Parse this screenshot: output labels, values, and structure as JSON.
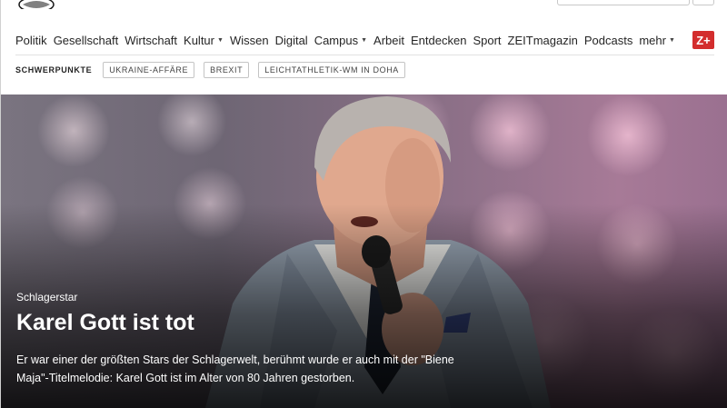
{
  "header": {
    "logo_text": "ZEIT ONLINE",
    "zplus_label": "Z+"
  },
  "nav": {
    "items": [
      {
        "label": "Politik",
        "has_caret": false
      },
      {
        "label": "Gesellschaft",
        "has_caret": false
      },
      {
        "label": "Wirtschaft",
        "has_caret": false
      },
      {
        "label": "Kultur",
        "has_caret": true
      },
      {
        "label": "Wissen",
        "has_caret": false
      },
      {
        "label": "Digital",
        "has_caret": false
      },
      {
        "label": "Campus",
        "has_caret": true
      },
      {
        "label": "Arbeit",
        "has_caret": false
      },
      {
        "label": "Entdecken",
        "has_caret": false
      },
      {
        "label": "Sport",
        "has_caret": false
      },
      {
        "label": "ZEITmagazin",
        "has_caret": false
      },
      {
        "label": "Podcasts",
        "has_caret": false
      },
      {
        "label": "mehr",
        "has_caret": true
      }
    ],
    "caret_icon": "chevron-down-icon"
  },
  "subnav": {
    "label": "SCHWERPUNKTE",
    "tags": [
      "UKRAINE-AFFÄRE",
      "BREXIT",
      "LEICHTATHLETIK-WM IN DOHA"
    ]
  },
  "hero": {
    "kicker": "Schlagerstar",
    "headline": "Karel Gott ist tot",
    "teaser": "Er war einer der größten Stars der Schlagerwelt, berühmt wurde er auch mit der \"Biene Maja\"-Titelmelodie: Karel Gott ist im Alter von 80 Jahren gestorben."
  },
  "colors": {
    "zplus_red": "#d32d2d",
    "text": "#252525"
  }
}
